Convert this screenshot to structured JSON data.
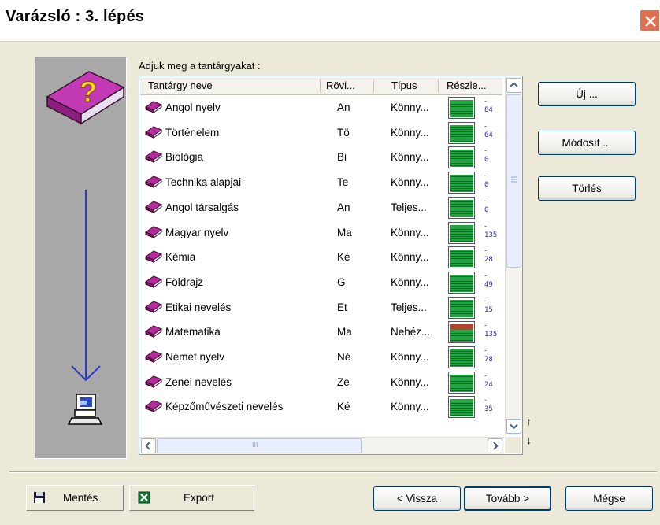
{
  "window": {
    "title": "Varázsló : 3. lépés"
  },
  "main": {
    "prompt": "Adjuk meg a tantárgyakat :",
    "columns": [
      "Tantárgy neve",
      "Rövi...",
      "Típus",
      "Részle..."
    ],
    "rows": [
      {
        "name": "Angol nyelv",
        "abbr": "An",
        "type": "Könny...",
        "fill": 0.9,
        "count": "84",
        "color": "green"
      },
      {
        "name": "Történelem",
        "abbr": "Tö",
        "type": "Könny...",
        "fill": 0.9,
        "count": "64",
        "color": "green"
      },
      {
        "name": "Biológia",
        "abbr": "Bi",
        "type": "Könny...",
        "fill": 0.9,
        "count": "0",
        "color": "green"
      },
      {
        "name": "Technika alapjai",
        "abbr": "Te",
        "type": "Könny...",
        "fill": 0.9,
        "count": "0",
        "color": "green"
      },
      {
        "name": "Angol társalgás",
        "abbr": "An",
        "type": "Teljes...",
        "fill": 0.9,
        "count": "0",
        "color": "green"
      },
      {
        "name": "Magyar nyelv",
        "abbr": "Ma",
        "type": "Könny...",
        "fill": 0.9,
        "count": "135",
        "color": "green"
      },
      {
        "name": "Kémia",
        "abbr": "Ké",
        "type": "Könny...",
        "fill": 0.9,
        "count": "28",
        "color": "green"
      },
      {
        "name": "Földrajz",
        "abbr": "G",
        "type": "Könny...",
        "fill": 0.9,
        "count": "49",
        "color": "green"
      },
      {
        "name": "Etikai nevelés",
        "abbr": "Et",
        "type": "Teljes...",
        "fill": 0.9,
        "count": "15",
        "color": "green"
      },
      {
        "name": "Matematika",
        "abbr": "Ma",
        "type": "Nehéz...",
        "fill": 0.9,
        "count": "135",
        "color": "mixed"
      },
      {
        "name": "Német nyelv",
        "abbr": "Né",
        "type": "Könny...",
        "fill": 0.9,
        "count": "78",
        "color": "green"
      },
      {
        "name": "Zenei nevelés",
        "abbr": "Ze",
        "type": "Könny...",
        "fill": 0.9,
        "count": "24",
        "color": "green"
      },
      {
        "name": "Képzőművészeti nevelés",
        "abbr": "Ké",
        "type": "Könny...",
        "fill": 0.9,
        "count": "35",
        "color": "green"
      }
    ],
    "hscroll_label": "III",
    "sort_up": "↑",
    "sort_down": "↓"
  },
  "right_buttons": {
    "new": "Új ...",
    "modify": "Módosít ...",
    "delete": "Törlés"
  },
  "footer": {
    "save": "Mentés",
    "export": "Export",
    "back": "< Vissza",
    "next": "Tovább >",
    "cancel": "Mégse"
  },
  "colors": {
    "accent": "#003c74",
    "bar_green": "#1aa83e",
    "bar_red": "#b3422a",
    "arrow": "#2b3bc8",
    "book": "#b52a9c"
  }
}
